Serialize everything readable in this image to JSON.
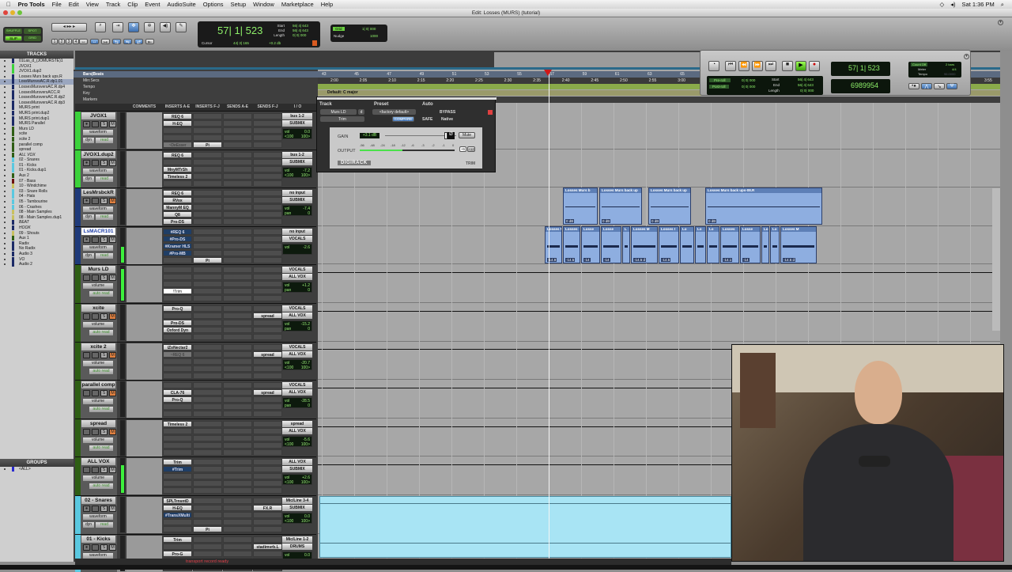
{
  "menubar": {
    "apple": "",
    "app": "Pro Tools",
    "items": [
      "File",
      "Edit",
      "View",
      "Track",
      "Clip",
      "Event",
      "AudioSuite",
      "Options",
      "Setup",
      "Window",
      "Marketplace",
      "Help"
    ],
    "clock": "Sat 1:36 PM"
  },
  "window": {
    "title": "Edit: Losses (MURS) (tutorial)"
  },
  "toolbar": {
    "modes": [
      "SHUFFLE",
      "SPOT",
      "SLIP",
      "GRID"
    ],
    "zoom_presets": [
      "1",
      "2",
      "3",
      "4",
      "5"
    ],
    "counter": "57| 1| 523",
    "start_label": "Start",
    "start": "56| 4| 643",
    "end_label": "End",
    "end": "56| 4| 643",
    "length_label": "Length",
    "length": "0| 0| 000",
    "cursor_label": "Cursor",
    "cursor": "44| 3| 165",
    "cursor_db": "+0.2 db",
    "grid_label": "Grid",
    "grid": "1| 0| 000",
    "nudge_label": "Nudge",
    "nudge": "1000"
  },
  "rulers": {
    "names": [
      "Bars|Beats",
      "Min:Secs",
      "Tempo",
      "Key",
      "Markers"
    ],
    "key_sig": "Default: C major",
    "bars": [
      "43",
      "45",
      "47",
      "49",
      "51",
      "53",
      "55",
      "57",
      "59",
      "61",
      "63",
      "65"
    ],
    "times": [
      "2:00",
      "2:05",
      "2:10",
      "2:15",
      "2:20",
      "2:25",
      "2:30",
      "2:35",
      "2:40",
      "2:45",
      "2:50",
      "2:55",
      "3:00"
    ],
    "far_time": "3:55"
  },
  "tracks_panel": {
    "title": "TRACKS",
    "items": [
      {
        "n": "01Las_d_(JOMURSTE)1",
        "c": "#1b2a66"
      },
      {
        "n": "JVOX1",
        "c": "#3bd23b"
      },
      {
        "n": "JVOX1.dup2",
        "c": "#3bd23b"
      },
      {
        "n": "Losses Murs back ups.R",
        "c": "#1b2a66"
      },
      {
        "n": "LossMursvsAC.R.dp1.01",
        "c": "#1b2a66",
        "sel": true
      },
      {
        "n": "LossesMursversAC.R.dp4",
        "c": "#1b2a66"
      },
      {
        "n": "LossesMursversACC.R",
        "c": "#1b2a66"
      },
      {
        "n": "LossesMursversAC.R.dp2",
        "c": "#1b2a66"
      },
      {
        "n": "LossesMursversAC.R.dp3",
        "c": "#1b2a66"
      },
      {
        "n": "MURS print",
        "c": "#1b2a66"
      },
      {
        "n": "MURS print.dup2",
        "c": "#1b2a66"
      },
      {
        "n": "MURS print.dup1",
        "c": "#1b2a66"
      },
      {
        "n": "MURS Parallel",
        "c": "#1b2a66"
      },
      {
        "n": "Murs LD",
        "c": "#2e5e14"
      },
      {
        "n": "xcite",
        "c": "#2e5e14"
      },
      {
        "n": "xcite 2",
        "c": "#2e5e14"
      },
      {
        "n": "parallel comp",
        "c": "#2e5e14"
      },
      {
        "n": "spread",
        "c": "#2e5e14"
      },
      {
        "n": "ALL VOX",
        "c": "#2e5e14"
      },
      {
        "n": "02 - Snares",
        "c": "#5ac8e0"
      },
      {
        "n": "01 - Kicks",
        "c": "#5ac8e0"
      },
      {
        "n": "01 - Kicks.dup1",
        "c": "#5ac8e0"
      },
      {
        "n": "Aux 2",
        "c": "#2e5e14"
      },
      {
        "n": "07 - Bass",
        "c": "#6a1010"
      },
      {
        "n": "10 - Windchime",
        "c": "#c8c060"
      },
      {
        "n": "03 - Snare Rolls",
        "c": "#5ac8e0"
      },
      {
        "n": "04 - Hats",
        "c": "#5ac8e0"
      },
      {
        "n": "05 - Tambourine",
        "c": "#5ac8e0"
      },
      {
        "n": "06 - Crashes",
        "c": "#5ac8e0"
      },
      {
        "n": "08 - Main Samples",
        "c": "#c8c060"
      },
      {
        "n": "08 - Main Samples.dup1",
        "c": "#c8c060"
      },
      {
        "n": "BEAT",
        "c": "#1b2a66"
      },
      {
        "n": "HOOK",
        "c": "#1b2a66"
      },
      {
        "n": "09 - Shouts",
        "c": "#c8c060"
      },
      {
        "n": "Aux 1",
        "c": "#2e5e14"
      },
      {
        "n": "Radix",
        "c": "#1b2a66"
      },
      {
        "n": "No Radix",
        "c": "#1b2a66"
      },
      {
        "n": "Audio 3",
        "c": "#1b2a66"
      },
      {
        "n": "VO",
        "c": "#1b2a66"
      },
      {
        "n": "Audio 2",
        "c": "#1b2a66"
      }
    ]
  },
  "groups_panel": {
    "title": "GROUPS",
    "items": [
      "<ALL>"
    ]
  },
  "columns": [
    "COMMENTS",
    "INSERTS A-E",
    "INSERTS F-J",
    "SENDS A-E",
    "SENDS F-J",
    "I / O"
  ],
  "tracks": [
    {
      "name": "JVOX1",
      "color": "#3bd23b",
      "type": "audio",
      "view": "waveform",
      "auto": "read",
      "ins": [
        "REQ 6",
        "H-EQ",
        "",
        "",
        "~DeEsser"
      ],
      "insFJ": [
        "",
        "",
        "",
        "",
        "Pi"
      ],
      "sendsFJ": [],
      "io": [
        "bus 1-2",
        "SUBMIX"
      ],
      "vol": "0.0",
      "pan": [
        "<100",
        "100>"
      ],
      "meter": 0
    },
    {
      "name": "JVOX1.dup2",
      "color": "#3bd23b",
      "type": "audio",
      "view": "waveform",
      "auto": "read",
      "ins": [
        "REQ 6",
        "",
        "MnyMTrSh",
        "Timeless 2",
        ""
      ],
      "insFJ": [],
      "sendsFJ": [],
      "io": [
        "bus 1-2",
        "SUBMIX"
      ],
      "vol": "-7.2",
      "pan": [
        "<100",
        "100>"
      ],
      "meter": 0
    },
    {
      "name": "LesMrsbckR",
      "color": "#1e3a7a",
      "type": "audio",
      "view": "waveform",
      "auto": "read",
      "mute": true,
      "ins": [
        "REQ 6",
        "RVox",
        "MannyM EQ",
        "Q8",
        "Pro-DS"
      ],
      "insFJ": [],
      "sendsFJ": [],
      "io": [
        "no input",
        "SUBMIX"
      ],
      "vol": "-7.4",
      "pan": [
        "pan",
        "0"
      ],
      "meter": 0
    },
    {
      "name": "LsMACR101",
      "color": "#1e3a7a",
      "type": "audio",
      "sel": true,
      "view": "waveform",
      "auto": "read",
      "ins": [
        "#REQ 6",
        "#Pro-DS",
        "#Kramer HLS",
        "#Pro-MB",
        ""
      ],
      "insFJ": [
        "",
        "",
        "",
        "",
        "Pi"
      ],
      "sendsFJ": [],
      "io": [
        "no input",
        "VOCALS"
      ],
      "vol": "-2.6",
      "pan": [],
      "meter": 20
    },
    {
      "name": "Murs LD",
      "color": "#2e5e14",
      "type": "aux",
      "view": "volume",
      "auto": "auto read",
      "ins": [
        "",
        "",
        "",
        "!Trim",
        ""
      ],
      "insFJ": [],
      "sendsFJ": [],
      "io": [
        "VOCALS",
        "ALL VOX"
      ],
      "vol": "+1.2",
      "pan": [
        "pan",
        "0"
      ],
      "meter": 40
    },
    {
      "name": "xcite",
      "color": "#2e5e14",
      "type": "aux",
      "view": "volume",
      "auto": "auto read",
      "mute": true,
      "ins": [
        "Pro-Q",
        "",
        "Pro-DS",
        "Oxford Dyn",
        ""
      ],
      "insFJ": [],
      "sendsFJ": [
        "",
        "spread"
      ],
      "io": [
        "VOCALS",
        "ALL VOX"
      ],
      "vol": "-15.2",
      "pan": [
        "pan",
        "0"
      ],
      "meter": 0
    },
    {
      "name": "xcite 2",
      "color": "#2e5e14",
      "type": "aux",
      "view": "volume",
      "auto": "auto read",
      "mute": true,
      "ins": [
        "iZoNectar2",
        "~REQ 6",
        "",
        "",
        ""
      ],
      "insFJ": [],
      "sendsFJ": [
        "",
        "spread"
      ],
      "io": [
        "VOCALS",
        "ALL VOX"
      ],
      "vol": "-20.7",
      "pan": [
        "<100",
        "100>"
      ],
      "meter": 0
    },
    {
      "name": "parallel comp",
      "color": "#2e5e14",
      "type": "aux",
      "view": "volume",
      "auto": "auto read",
      "mute": true,
      "ins": [
        "",
        "CLA-76",
        "Pro-Q",
        "",
        ""
      ],
      "insFJ": [],
      "sendsFJ": [
        "",
        "spread"
      ],
      "io": [
        "VOCALS",
        "ALL VOX"
      ],
      "vol": "-28.5",
      "pan": [
        "pan",
        "0"
      ],
      "meter": 0
    },
    {
      "name": "spread",
      "color": "#2e5e14",
      "type": "aux",
      "view": "volume",
      "auto": "auto read",
      "mute": true,
      "ins": [
        "Timeless 2",
        "",
        "",
        "",
        ""
      ],
      "insFJ": [],
      "sendsFJ": [],
      "io": [
        "spread",
        "ALL VOX"
      ],
      "vol": "-5.6",
      "pan": [
        "<100",
        "100>"
      ],
      "meter": 0
    },
    {
      "name": "ALL VOX",
      "color": "#2e5e14",
      "type": "aux",
      "view": "volume",
      "auto": "auto read",
      "ins": [
        "Trim",
        "#Trim",
        "",
        "",
        ""
      ],
      "insFJ": [],
      "sendsFJ": [],
      "io": [
        "ALL VOX",
        "SUBMIX"
      ],
      "vol": "+2.6",
      "pan": [
        "<100",
        "100>"
      ],
      "meter": 35
    },
    {
      "name": "02 - Snares",
      "color": "#5ac8e0",
      "type": "audio",
      "view": "waveform",
      "auto": "read",
      "ins": [
        "SPLTrnsntD",
        "H-EQ",
        "#TransXMulti",
        "",
        ""
      ],
      "insFJ": [
        "",
        "",
        "",
        "",
        "Pi"
      ],
      "sendsFJ": [
        "",
        "FX.R"
      ],
      "io": [
        "Mic/Line 3-4",
        "SUBMIX"
      ],
      "vol": "0.0",
      "pan": [
        "<100",
        "100>"
      ],
      "meter": 0
    },
    {
      "name": "01 - Kicks",
      "color": "#5ac8e0",
      "type": "audio",
      "view": "waveform",
      "auto": "read",
      "ins": [
        "Trim",
        "",
        "Pro-G",
        "",
        ""
      ],
      "insFJ": [],
      "sendsFJ": [
        "",
        "stadimvrb.L"
      ],
      "io": [
        "Mic/Line 1-2",
        "DRUMS"
      ],
      "vol": "0.0",
      "pan": [],
      "meter": 0
    }
  ],
  "track_buttons": {
    "solo": "S",
    "mute": "M",
    "dyn": "dyn",
    "vol_label": "vol",
    "pan_label": "pan"
  },
  "clips": {
    "row3": [
      {
        "n": "Losses Murs b",
        "g": "0 dB"
      },
      {
        "n": "Losses Murs back up",
        "g": "0 dB"
      },
      {
        "n": "Losses Murs back up",
        "g": "0 dB"
      },
      {
        "n": "Losses Murs back ups-08.R",
        "g": "0 dB"
      }
    ],
    "row4": [
      {
        "n": "Losses M",
        "g": "-14.9"
      },
      {
        "n": "Losses",
        "g": "-14.5"
      },
      {
        "n": "Losse",
        "g": "-14"
      },
      {
        "n": "Losse",
        "g": "-14"
      },
      {
        "n": "L",
        "g": ""
      },
      {
        "n": "Losses M",
        "g": "-14.5 d"
      },
      {
        "n": "Losses I",
        "g": "-14.5"
      },
      {
        "n": "Lo",
        "g": ""
      },
      {
        "n": "Lo",
        "g": ""
      },
      {
        "n": "Lo",
        "g": ""
      },
      {
        "n": "Losses",
        "g": "-14.1"
      },
      {
        "n": "Losse",
        "g": "-14"
      },
      {
        "n": "Lo",
        "g": ""
      },
      {
        "n": "Lo",
        "g": ""
      },
      {
        "n": "Losses M",
        "g": "-14.5 d"
      }
    ]
  },
  "plugin": {
    "track_label": "Track",
    "preset_label": "Preset",
    "auto_label": "Auto",
    "track": "Murs LD",
    "track_suffix": "d",
    "insert": "Trim",
    "preset": "<factory default>",
    "compare": "COMPARE",
    "bypass": "BYPASS",
    "safe": "SAFE",
    "native": "Native",
    "gain_label": "GAIN",
    "gain": "+3.1 dB",
    "phase": "Ø",
    "mute": "Mute",
    "output_label": "OUTPUT",
    "scale": [
      "-56",
      "-48",
      "-24",
      "-18",
      "-12",
      "-6",
      "-3",
      "-2",
      "-1",
      "0"
    ],
    "range": [
      "+6",
      "+12"
    ],
    "brand": "DIGIRACK",
    "name": "TRIM",
    "gain_fraction": 0.88
  },
  "transport": {
    "preroll_label": "Pre-roll",
    "preroll": "0| 0| 000",
    "postroll_label": "Post-roll",
    "postroll": "0| 0| 000",
    "start_label": "Start",
    "start": "56| 4| 643",
    "end_label": "End",
    "end": "56| 4| 643",
    "length_label": "Length",
    "length": "0| 0| 000",
    "counter": "57| 1| 523",
    "samples": "6989954",
    "countoff": "Count Off",
    "countoff_val": "2 bars",
    "meter_label": "Meter",
    "meter": "4/4",
    "tempo_label": "Tempo",
    "tempo": "96.0000"
  },
  "status": {
    "message": "transport record ready"
  },
  "colors": {
    "accent_green": "#8ef06a",
    "selection_blue": "#1f3fa8",
    "clip_blue": "#8eaee0",
    "snare_clip": "#a8e4f4",
    "playhead_red": "#d01818"
  }
}
